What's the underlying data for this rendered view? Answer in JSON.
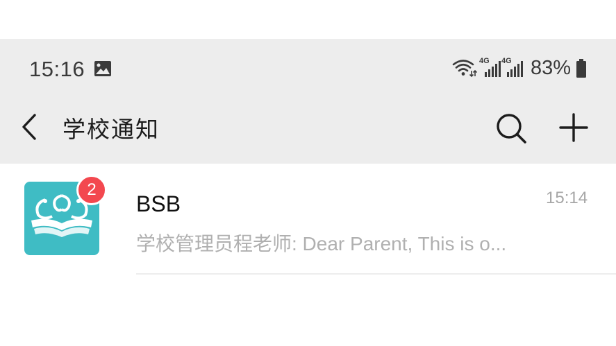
{
  "status_bar": {
    "time": "15:16",
    "network_1": "4G",
    "network_2": "4G",
    "battery": "83%",
    "icons": [
      "gallery-icon",
      "wifi-icon",
      "signal-icon",
      "signal-icon",
      "battery-icon"
    ]
  },
  "header": {
    "title": "学校通知",
    "icons": [
      "back-arrow-icon",
      "search-icon",
      "plus-icon"
    ]
  },
  "chats": [
    {
      "name": "BSB",
      "time": "15:14",
      "preview": "学校管理员程老师: Dear Parent, This is o...",
      "unread": "2"
    }
  ],
  "colors": {
    "header_bg": "#ededed",
    "avatar_bg": "#3fbcc4",
    "badge_bg": "#f3484f"
  }
}
